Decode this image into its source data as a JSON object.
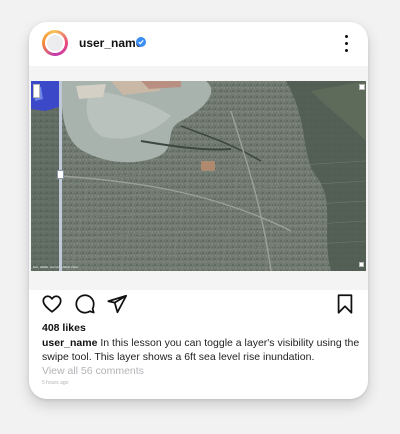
{
  "post": {
    "username": "user_name",
    "likes": "408 likes",
    "caption_user": "user_name",
    "caption_text": " In this lesson you can toggle a layer's visibility using the swipe tool. This layer shows a 6ft sea level rise inundation.",
    "comments_link": "View all 56 comments",
    "timestamp": "5 hours ago"
  },
  "map": {
    "attribution": "Esri, HERE, Garmin, USGS, NGA"
  },
  "icons": {
    "avatar": "avatar-icon",
    "verified": "verified-badge-icon",
    "more": "more-vertical-icon",
    "like": "heart-icon",
    "comment": "comment-bubble-icon",
    "share": "paper-plane-icon",
    "save": "bookmark-icon"
  },
  "colors": {
    "verified": "#3a8df5",
    "inundation": "#3b48c8",
    "text": "#111111",
    "muted": "#b4b4b8"
  }
}
